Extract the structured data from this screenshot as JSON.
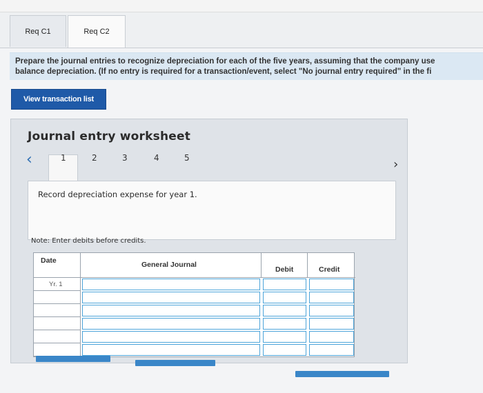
{
  "tabs": [
    {
      "label": "Req C1"
    },
    {
      "label": "Req C2"
    }
  ],
  "instructions": {
    "line1": "Prepare the journal entries to recognize depreciation for each of the five years, assuming that the company use",
    "line2": "balance depreciation. (If no entry is required for a transaction/event, select \"No journal entry required\" in the fi"
  },
  "view_transaction_button": "View transaction list",
  "worksheet": {
    "title": "Journal entry worksheet",
    "steps": [
      "1",
      "2",
      "3",
      "4",
      "5"
    ],
    "active_step": 1,
    "description": "Record depreciation expense for year 1.",
    "note": "Note: Enter debits before credits."
  },
  "journal_table": {
    "headers": {
      "date": "Date",
      "account": "General Journal",
      "debit": "Debit",
      "credit": "Credit"
    },
    "rows": [
      {
        "date": "Yr. 1",
        "account": "",
        "debit": "",
        "credit": ""
      },
      {
        "date": "",
        "account": "",
        "debit": "",
        "credit": ""
      },
      {
        "date": "",
        "account": "",
        "debit": "",
        "credit": ""
      },
      {
        "date": "",
        "account": "",
        "debit": "",
        "credit": ""
      },
      {
        "date": "",
        "account": "",
        "debit": "",
        "credit": ""
      },
      {
        "date": "",
        "account": "",
        "debit": "",
        "credit": ""
      }
    ]
  },
  "colors": {
    "accent": "#1f5aa8",
    "banner": "#dbe8f3",
    "input_border": "#4aa3d9"
  }
}
